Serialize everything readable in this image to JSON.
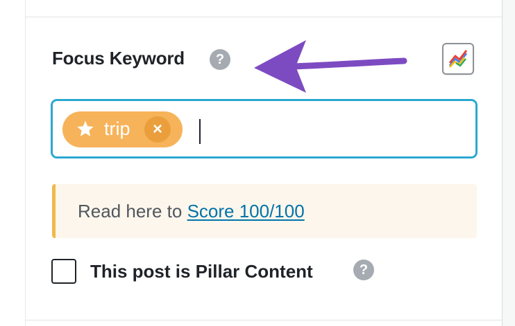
{
  "focus_keyword": {
    "label": "Focus Keyword",
    "help_icon": "question-circle-icon",
    "trends_icon": "trend-chart-icon",
    "tags": [
      {
        "icon": "star-icon",
        "label": "trip",
        "remove_icon": "close-icon",
        "remove_label": "×"
      }
    ],
    "input_value": ""
  },
  "notice": {
    "prefix": "Read here to ",
    "link_text": "Score 100/100"
  },
  "pillar": {
    "label": "This post is Pillar Content",
    "checked": false,
    "help_icon": "question-circle-icon"
  },
  "annotation": {
    "arrow_color": "#7d4bc1"
  },
  "colors": {
    "field_border": "#2ba8d1",
    "tag_bg": "#f7b35a",
    "link": "#0073aa",
    "notice_border": "#f0b94b"
  },
  "help_glyph": "?"
}
